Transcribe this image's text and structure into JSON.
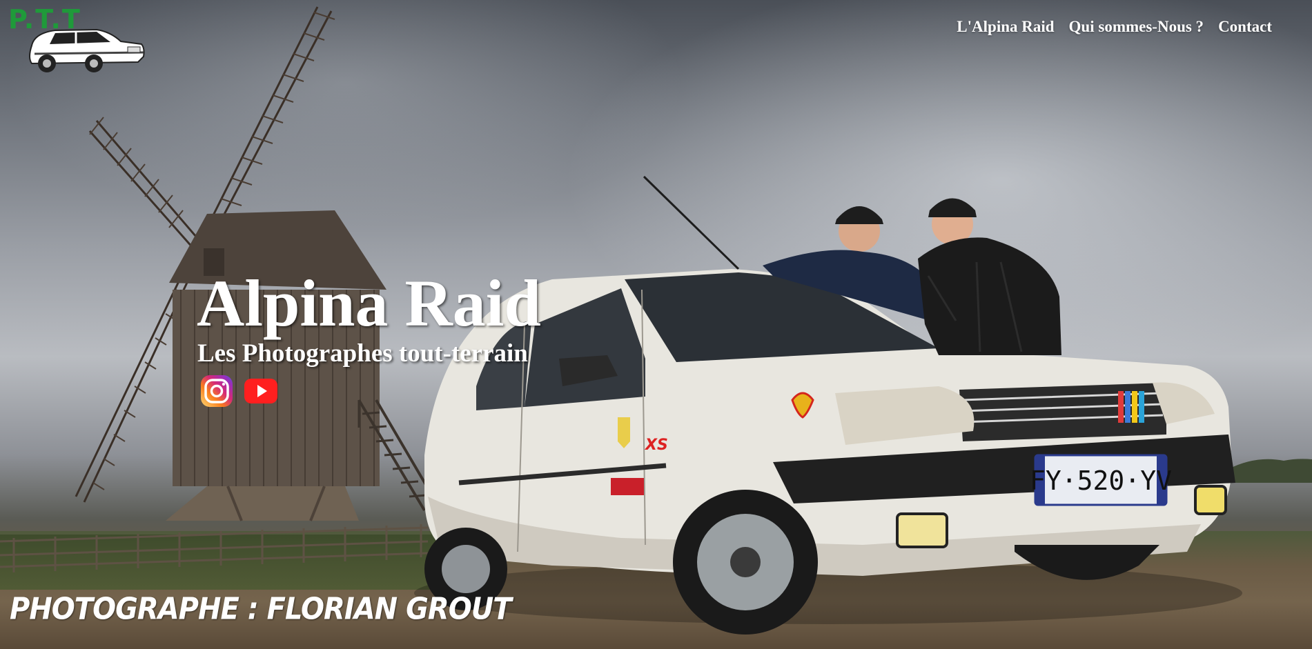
{
  "logo": {
    "text": "P.T.T",
    "color": "#1f9a3a"
  },
  "nav": {
    "items": [
      {
        "label": "L'Alpina Raid"
      },
      {
        "label": "Qui sommes-Nous ?"
      },
      {
        "label": "Contact"
      }
    ]
  },
  "hero": {
    "title": "Alpina Raid",
    "subtitle": "Les Photographes tout-terrain",
    "plate": "FY·520·YV",
    "socials": [
      {
        "icon": "instagram-icon"
      },
      {
        "icon": "youtube-icon"
      }
    ]
  },
  "credit": {
    "text": "PHOTOGRAPHE : FLORIAN GROUT"
  }
}
